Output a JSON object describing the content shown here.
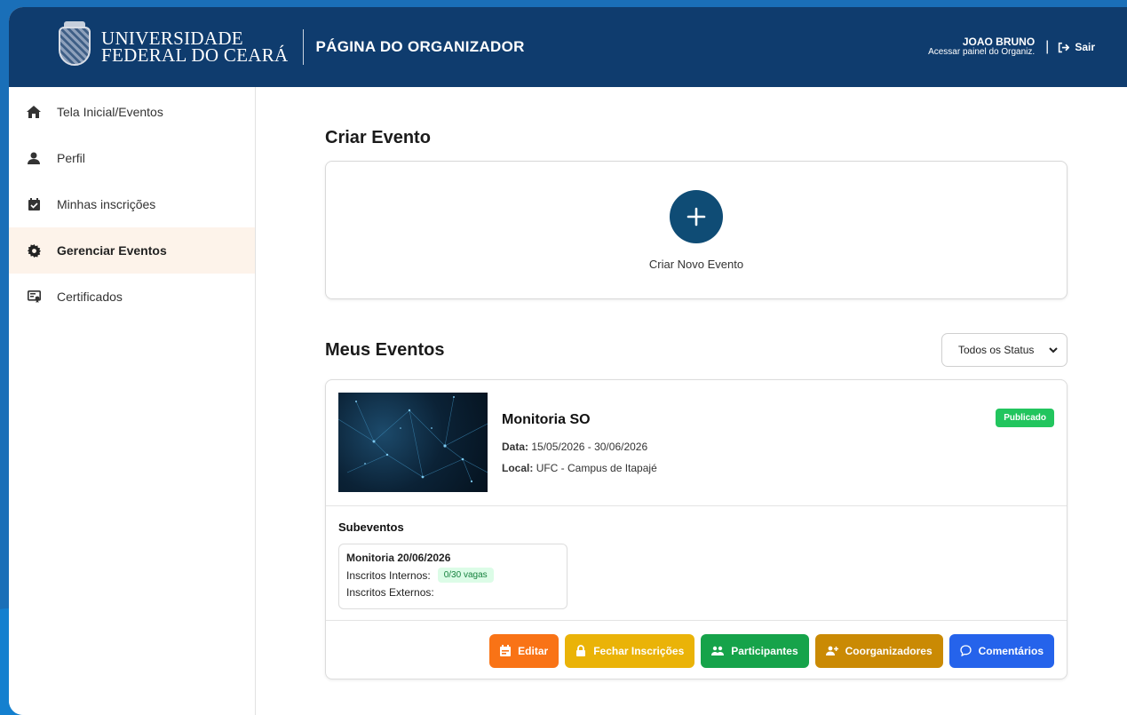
{
  "header": {
    "university_line1": "UNIVERSIDADE",
    "university_line2": "FEDERAL DO CEARÁ",
    "page_title": "PÁGINA DO ORGANIZADOR",
    "user_name": "JOAO BRUNO",
    "user_subtitle": "Acessar painel do Organiz.",
    "separator": "|",
    "logout_label": "Sair"
  },
  "sidebar": {
    "items": [
      {
        "label": "Tela Inicial/Eventos",
        "icon": "home-icon"
      },
      {
        "label": "Perfil",
        "icon": "user-icon"
      },
      {
        "label": "Minhas inscrições",
        "icon": "calendar-check-icon"
      },
      {
        "label": "Gerenciar Eventos",
        "icon": "gear-icon",
        "active": true
      },
      {
        "label": "Certificados",
        "icon": "certificate-icon"
      }
    ]
  },
  "create": {
    "section_title": "Criar Evento",
    "button_label": "Criar Novo Evento"
  },
  "events": {
    "section_title": "Meus Eventos",
    "status_filter": "Todos os Status",
    "items": [
      {
        "title": "Monitoria SO",
        "status": "Publicado",
        "date_label": "Data:",
        "date_value": "15/05/2026 - 30/06/2026",
        "location_label": "Local:",
        "location_value": "UFC - Campus de Itapajé",
        "subevents_title": "Subeventos",
        "subevents": [
          {
            "name": "Monitoria 20/06/2026",
            "internal_label": "Inscritos Internos:",
            "internal_value": "0/30 vagas",
            "external_label": "Inscritos Externos:"
          }
        ],
        "actions": {
          "edit": "Editar",
          "close": "Fechar Inscrições",
          "participants": "Participantes",
          "coorganizers": "Coorganizadores",
          "comments": "Comentários"
        }
      }
    ]
  },
  "colors": {
    "header_bg": "#0f3c6e",
    "plus_circle": "#0f4c75",
    "edit": "#f97316",
    "close": "#eab308",
    "participants": "#16a34a",
    "coorganizers": "#ca8a04",
    "comments": "#2563eb",
    "published": "#22c55e"
  }
}
